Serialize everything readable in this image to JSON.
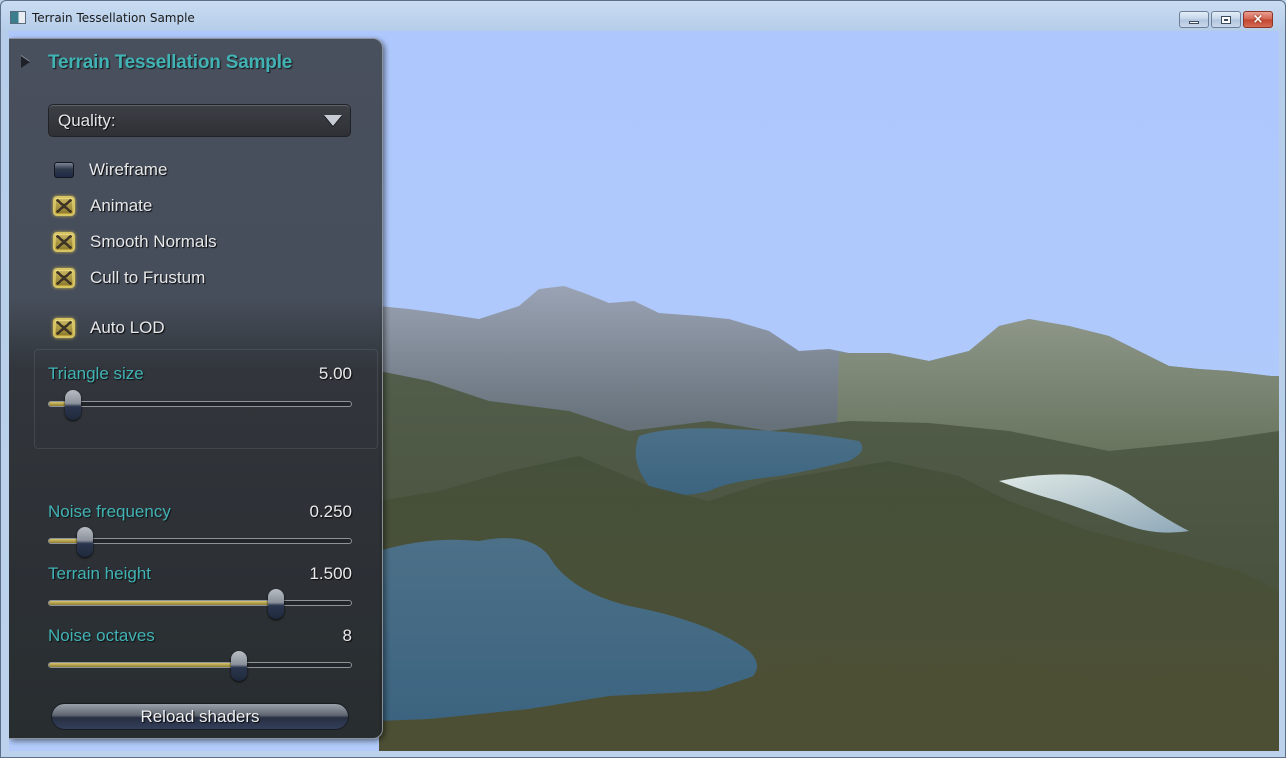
{
  "window": {
    "title": "Terrain Tessellation Sample",
    "controls": {
      "minimize": "minimize-icon",
      "maximize": "maximize-icon",
      "close": "×"
    }
  },
  "panel": {
    "title": "Terrain Tessellation Sample",
    "quality_dropdown": {
      "selected": "Quality:"
    },
    "checkboxes": [
      {
        "label": "Wireframe",
        "checked": false
      },
      {
        "label": "Animate",
        "checked": true
      },
      {
        "label": "Smooth Normals",
        "checked": true
      },
      {
        "label": "Cull to Frustum",
        "checked": true
      },
      {
        "label": "Auto LOD",
        "checked": true
      }
    ],
    "sliders": [
      {
        "label": "Triangle size",
        "value": "5.00",
        "fraction": 0.08
      },
      {
        "label": "Noise frequency",
        "value": "0.250",
        "fraction": 0.12
      },
      {
        "label": "Terrain height",
        "value": "1.500",
        "fraction": 0.75
      },
      {
        "label": "Noise octaves",
        "value": "8",
        "fraction": 0.63
      }
    ],
    "reload_button": "Reload shaders"
  },
  "colors": {
    "sky": "#aec8fd",
    "accent_text": "#3fb3b3",
    "checkbox_gold": "#c9b24a",
    "water": "#3f6a86",
    "terrain": "#4f5a3a"
  }
}
